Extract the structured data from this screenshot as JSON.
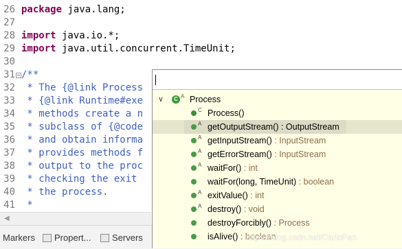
{
  "editor": {
    "lines": [
      {
        "no": "26",
        "segments": [
          {
            "t": "package",
            "c": "kw"
          },
          {
            "t": " java.lang;",
            "c": ""
          }
        ]
      },
      {
        "no": "27",
        "segments": []
      },
      {
        "no": "28",
        "segments": [
          {
            "t": "import",
            "c": "kw"
          },
          {
            "t": " java.io.*;",
            "c": ""
          }
        ]
      },
      {
        "no": "29",
        "segments": [
          {
            "t": "import",
            "c": "kw"
          },
          {
            "t": " java.util.concurrent.TimeUnit;",
            "c": ""
          }
        ]
      },
      {
        "no": "30",
        "segments": []
      },
      {
        "no": "31",
        "segments": [
          {
            "t": "/**",
            "c": "cm"
          }
        ]
      },
      {
        "no": "32",
        "segments": [
          {
            "t": " * The {@link Process",
            "c": "cm"
          }
        ]
      },
      {
        "no": "33",
        "segments": [
          {
            "t": " * {@link Runtime#exe",
            "c": "cm"
          }
        ]
      },
      {
        "no": "34",
        "segments": [
          {
            "t": " * methods create a n",
            "c": "cm"
          }
        ]
      },
      {
        "no": "35",
        "segments": [
          {
            "t": " * subclass of {@code",
            "c": "cm"
          }
        ]
      },
      {
        "no": "36",
        "segments": [
          {
            "t": " * and obtain informa",
            "c": "cm"
          }
        ]
      },
      {
        "no": "37",
        "segments": [
          {
            "t": " * provides methods f",
            "c": "cm"
          }
        ]
      },
      {
        "no": "38",
        "segments": [
          {
            "t": " * output to the proc",
            "c": "cm"
          }
        ]
      },
      {
        "no": "39",
        "segments": [
          {
            "t": " * checking the exit ",
            "c": "cm"
          }
        ]
      },
      {
        "no": "40",
        "segments": [
          {
            "t": " * the process.",
            "c": "cm"
          }
        ]
      },
      {
        "no": "41",
        "segments": [
          {
            "t": " *",
            "c": "cm"
          }
        ]
      }
    ]
  },
  "bottom_tabs": [
    {
      "label": "Markers",
      "icon": "markers-icon"
    },
    {
      "label": "Propert...",
      "icon": "properties-icon"
    },
    {
      "label": "Servers",
      "icon": "servers-icon"
    }
  ],
  "popup": {
    "filter_value": "",
    "root": {
      "label": "Process",
      "icon": "class-icon",
      "badge": "A"
    },
    "items": [
      {
        "name": "Process()",
        "ret": "",
        "badge": "C",
        "selected": false
      },
      {
        "name": "getOutputStream()",
        "ret": " : OutputStream",
        "badge": "A",
        "selected": true
      },
      {
        "name": "getInputStream()",
        "ret": " : InputStream",
        "badge": "A",
        "selected": false
      },
      {
        "name": "getErrorStream()",
        "ret": " : InputStream",
        "badge": "A",
        "selected": false
      },
      {
        "name": "waitFor()",
        "ret": " : int",
        "badge": "A",
        "selected": false
      },
      {
        "name": "waitFor(long, TimeUnit)",
        "ret": " : boolean",
        "badge": "",
        "selected": false
      },
      {
        "name": "exitValue()",
        "ret": " : int",
        "badge": "A",
        "selected": false
      },
      {
        "name": "destroy()",
        "ret": " : void",
        "badge": "A",
        "selected": false
      },
      {
        "name": "destroyForcibly()",
        "ret": " : Process",
        "badge": "",
        "selected": false
      },
      {
        "name": "isAlive()",
        "ret": " : boolean",
        "badge": "",
        "selected": false
      }
    ]
  },
  "watermark": "https://blog.csdn.net/CarloPan"
}
